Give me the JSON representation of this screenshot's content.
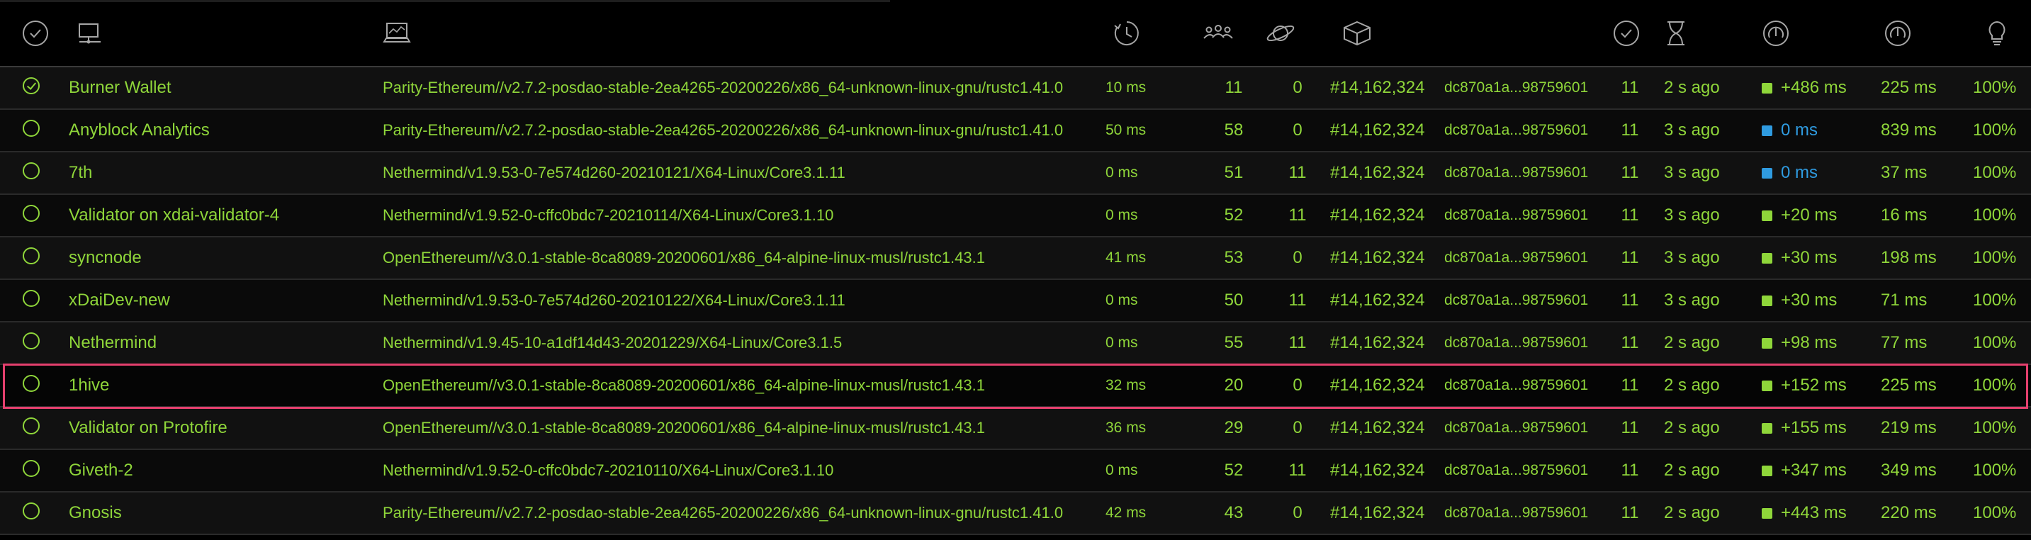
{
  "colors": {
    "accent": "#8fd63a",
    "highlight_border": "#e5406e",
    "blue_status": "#2f9be0",
    "header_icon": "#a6a6a6"
  },
  "header_icons": [
    "check-circle-icon",
    "node-monitor-icon",
    "laptop-icon",
    "timer-icon",
    "peers-icon",
    "planet-icon",
    "cube-icon",
    "check-circle-icon",
    "hourglass-icon",
    "propagation-gauge-icon",
    "propagation-avg-gauge-icon",
    "lightbulb-icon"
  ],
  "rows": [
    {
      "name": "Burner Wallet",
      "client": "Parity-Ethereum//v2.7.2-posdao-stable-2ea4265-20200226/x86_64-unknown-linux-gnu/rustc1.41.0",
      "latency": "10 ms",
      "peers": "11",
      "pending": "0",
      "block": "#14,162,324",
      "hash": "dc870a1a...98759601",
      "txs": "11",
      "last_block": "2 s ago",
      "prop_color": "green",
      "propagation": "+486 ms",
      "avg_prop": "225 ms",
      "uptime": "100%",
      "status": "done"
    },
    {
      "name": "Anyblock Analytics",
      "client": "Parity-Ethereum//v2.7.2-posdao-stable-2ea4265-20200226/x86_64-unknown-linux-gnu/rustc1.41.0",
      "latency": "50 ms",
      "peers": "58",
      "pending": "0",
      "block": "#14,162,324",
      "hash": "dc870a1a...98759601",
      "txs": "11",
      "last_block": "3 s ago",
      "prop_color": "blue",
      "propagation": "0 ms",
      "avg_prop": "839 ms",
      "uptime": "100%",
      "status": "pending"
    },
    {
      "name": "7th",
      "client": "Nethermind/v1.9.53-0-7e574d260-20210121/X64-Linux/Core3.1.11",
      "latency": "0 ms",
      "peers": "51",
      "pending": "11",
      "block": "#14,162,324",
      "hash": "dc870a1a...98759601",
      "txs": "11",
      "last_block": "3 s ago",
      "prop_color": "blue",
      "propagation": "0 ms",
      "avg_prop": "37 ms",
      "uptime": "100%",
      "status": "pending"
    },
    {
      "name": "Validator on xdai-validator-4",
      "client": "Nethermind/v1.9.52-0-cffc0bdc7-20210114/X64-Linux/Core3.1.10",
      "latency": "0 ms",
      "peers": "52",
      "pending": "11",
      "block": "#14,162,324",
      "hash": "dc870a1a...98759601",
      "txs": "11",
      "last_block": "3 s ago",
      "prop_color": "green",
      "propagation": "+20 ms",
      "avg_prop": "16 ms",
      "uptime": "100%",
      "status": "pending"
    },
    {
      "name": "syncnode",
      "client": "OpenEthereum//v3.0.1-stable-8ca8089-20200601/x86_64-alpine-linux-musl/rustc1.43.1",
      "latency": "41 ms",
      "peers": "53",
      "pending": "0",
      "block": "#14,162,324",
      "hash": "dc870a1a...98759601",
      "txs": "11",
      "last_block": "3 s ago",
      "prop_color": "green",
      "propagation": "+30 ms",
      "avg_prop": "198 ms",
      "uptime": "100%",
      "status": "pending"
    },
    {
      "name": "xDaiDev-new",
      "client": "Nethermind/v1.9.53-0-7e574d260-20210122/X64-Linux/Core3.1.11",
      "latency": "0 ms",
      "peers": "50",
      "pending": "11",
      "block": "#14,162,324",
      "hash": "dc870a1a...98759601",
      "txs": "11",
      "last_block": "3 s ago",
      "prop_color": "green",
      "propagation": "+30 ms",
      "avg_prop": "71 ms",
      "uptime": "100%",
      "status": "pending"
    },
    {
      "name": "Nethermind",
      "client": "Nethermind/v1.9.45-10-a1df14d43-20201229/X64-Linux/Core3.1.5",
      "latency": "0 ms",
      "peers": "55",
      "pending": "11",
      "block": "#14,162,324",
      "hash": "dc870a1a...98759601",
      "txs": "11",
      "last_block": "2 s ago",
      "prop_color": "green",
      "propagation": "+98 ms",
      "avg_prop": "77 ms",
      "uptime": "100%",
      "status": "pending"
    },
    {
      "name": "1hive",
      "client": "OpenEthereum//v3.0.1-stable-8ca8089-20200601/x86_64-alpine-linux-musl/rustc1.43.1",
      "latency": "32 ms",
      "peers": "20",
      "pending": "0",
      "block": "#14,162,324",
      "hash": "dc870a1a...98759601",
      "txs": "11",
      "last_block": "2 s ago",
      "prop_color": "green",
      "propagation": "+152 ms",
      "avg_prop": "225 ms",
      "uptime": "100%",
      "status": "pending"
    },
    {
      "name": "Validator on Protofire",
      "client": "OpenEthereum//v3.0.1-stable-8ca8089-20200601/x86_64-alpine-linux-musl/rustc1.43.1",
      "latency": "36 ms",
      "peers": "29",
      "pending": "0",
      "block": "#14,162,324",
      "hash": "dc870a1a...98759601",
      "txs": "11",
      "last_block": "2 s ago",
      "prop_color": "green",
      "propagation": "+155 ms",
      "avg_prop": "219 ms",
      "uptime": "100%",
      "status": "pending"
    },
    {
      "name": "Giveth-2",
      "client": "Nethermind/v1.9.52-0-cffc0bdc7-20210110/X64-Linux/Core3.1.10",
      "latency": "0 ms",
      "peers": "52",
      "pending": "11",
      "block": "#14,162,324",
      "hash": "dc870a1a...98759601",
      "txs": "11",
      "last_block": "2 s ago",
      "prop_color": "green",
      "propagation": "+347 ms",
      "avg_prop": "349 ms",
      "uptime": "100%",
      "status": "pending"
    },
    {
      "name": "Gnosis",
      "client": "Parity-Ethereum//v2.7.2-posdao-stable-2ea4265-20200226/x86_64-unknown-linux-gnu/rustc1.41.0",
      "latency": "42 ms",
      "peers": "43",
      "pending": "0",
      "block": "#14,162,324",
      "hash": "dc870a1a...98759601",
      "txs": "11",
      "last_block": "2 s ago",
      "prop_color": "green",
      "propagation": "+443 ms",
      "avg_prop": "220 ms",
      "uptime": "100%",
      "status": "pending"
    }
  ]
}
